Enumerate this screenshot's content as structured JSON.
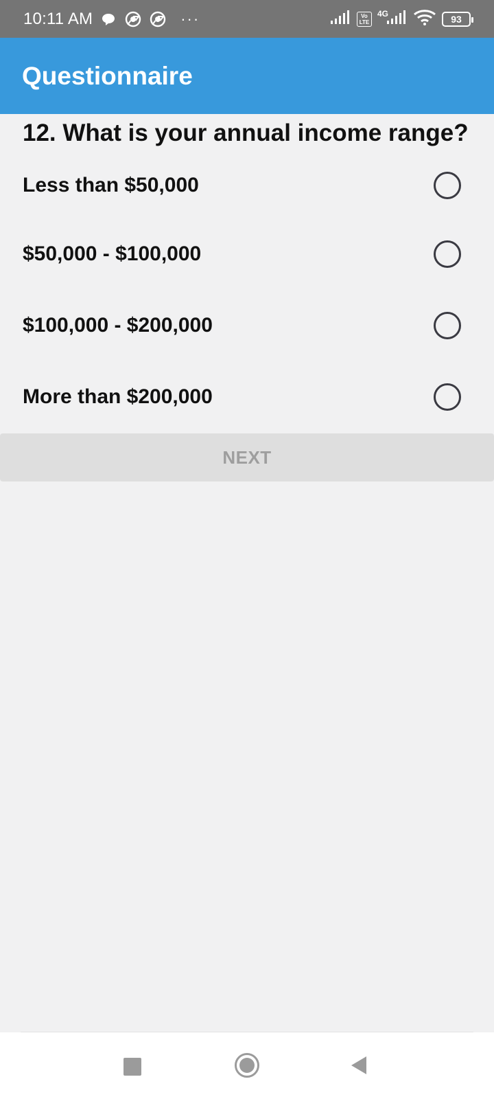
{
  "status_bar": {
    "time": "10:11 AM",
    "more": "···",
    "network": "4G",
    "lte": "Vo\nLTE",
    "battery": "93"
  },
  "app_bar": {
    "title": "Questionnaire",
    "color": "#3899dc"
  },
  "question": {
    "text": "12. What is your annual income range?",
    "options": [
      {
        "label": "Less than $50,000",
        "selected": false
      },
      {
        "label": "$50,000 - $100,000",
        "selected": false
      },
      {
        "label": "$100,000 - $200,000",
        "selected": false
      },
      {
        "label": "More than $200,000",
        "selected": false
      }
    ]
  },
  "next_button": {
    "label": "NEXT",
    "enabled": false
  },
  "nav_bar": {
    "icons": [
      "recents-icon",
      "home-icon",
      "back-icon"
    ]
  }
}
